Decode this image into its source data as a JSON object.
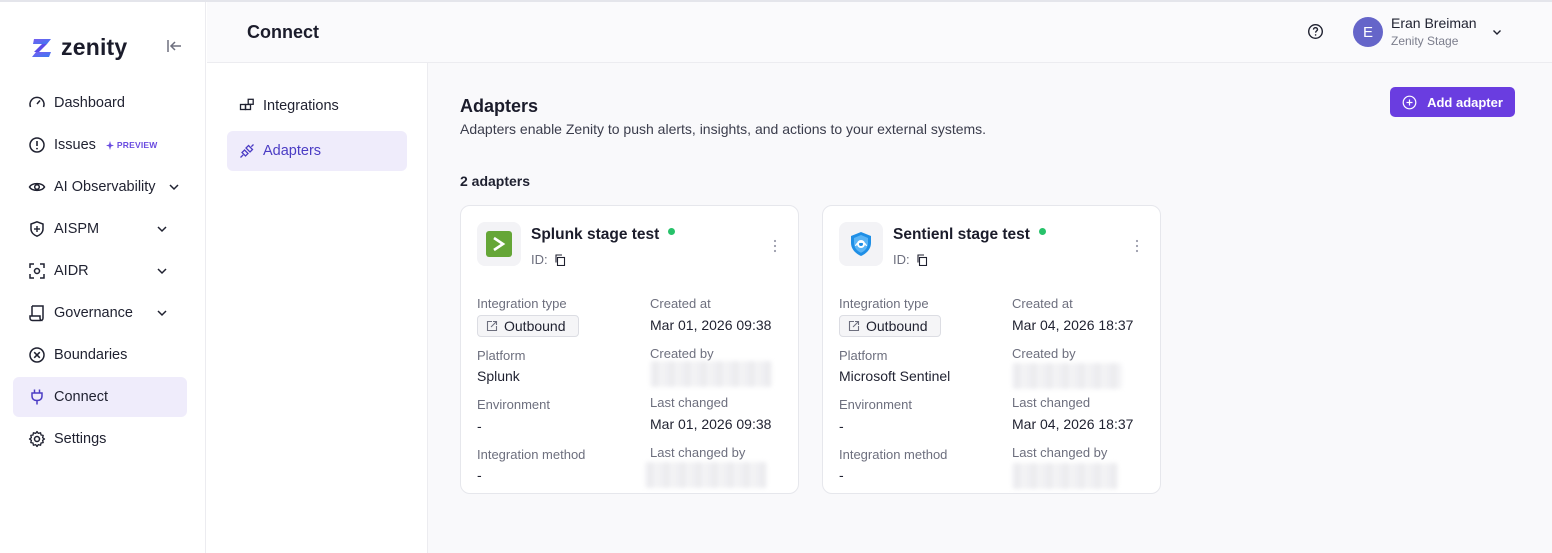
{
  "app": {
    "logo_text": "zenity"
  },
  "sidebar": {
    "items": [
      {
        "label": "Dashboard",
        "icon": "gauge-icon"
      },
      {
        "label": "Issues",
        "icon": "alert-circle-icon",
        "badge": "PREVIEW"
      },
      {
        "label": "AI Observability",
        "icon": "eye-icon",
        "expandable": true
      },
      {
        "label": "AISPM",
        "icon": "shield-icon",
        "expandable": true
      },
      {
        "label": "AIDR",
        "icon": "scan-icon",
        "expandable": true
      },
      {
        "label": "Governance",
        "icon": "scroll-icon",
        "expandable": true
      },
      {
        "label": "Boundaries",
        "icon": "x-circle-icon"
      },
      {
        "label": "Connect",
        "icon": "plug-icon",
        "active": true
      },
      {
        "label": "Settings",
        "icon": "gear-icon"
      }
    ]
  },
  "header": {
    "title": "Connect",
    "user": {
      "initial": "E",
      "name": "Eran Breiman",
      "org": "Zenity Stage"
    }
  },
  "subnav": {
    "items": [
      {
        "label": "Integrations",
        "icon": "integrations-icon"
      },
      {
        "label": "Adapters",
        "icon": "adapter-plug-icon",
        "active": true
      }
    ]
  },
  "main": {
    "title": "Adapters",
    "description": "Adapters enable Zenity to push alerts, insights, and actions to your external systems.",
    "add_button": "Add adapter",
    "count_label": "2 adapters",
    "labels": {
      "integration_type": "Integration type",
      "created_at": "Created at",
      "platform": "Platform",
      "created_by": "Created by",
      "environment": "Environment",
      "last_changed": "Last changed",
      "integration_method": "Integration method",
      "last_changed_by": "Last changed by",
      "id": "ID:"
    },
    "adapters": [
      {
        "name": "Splunk stage test",
        "status_color": "#27c26a",
        "logo": "splunk-logo-icon",
        "integration_type": "Outbound",
        "created_at": "Mar 01, 2026 09:38",
        "platform": "Splunk",
        "environment": "-",
        "last_changed": "Mar 01, 2026 09:38",
        "integration_method": "-"
      },
      {
        "name": "Sentienl stage test",
        "status_color": "#27c26a",
        "logo": "sentinel-logo-icon",
        "integration_type": "Outbound",
        "created_at": "Mar 04, 2026 18:37",
        "platform": "Microsoft Sentinel",
        "environment": "-",
        "last_changed": "Mar 04, 2026 18:37",
        "integration_method": "-"
      }
    ]
  },
  "colors": {
    "accent": "#6a3de0",
    "active_bg": "#efecfb",
    "status_ok": "#27c26a"
  }
}
